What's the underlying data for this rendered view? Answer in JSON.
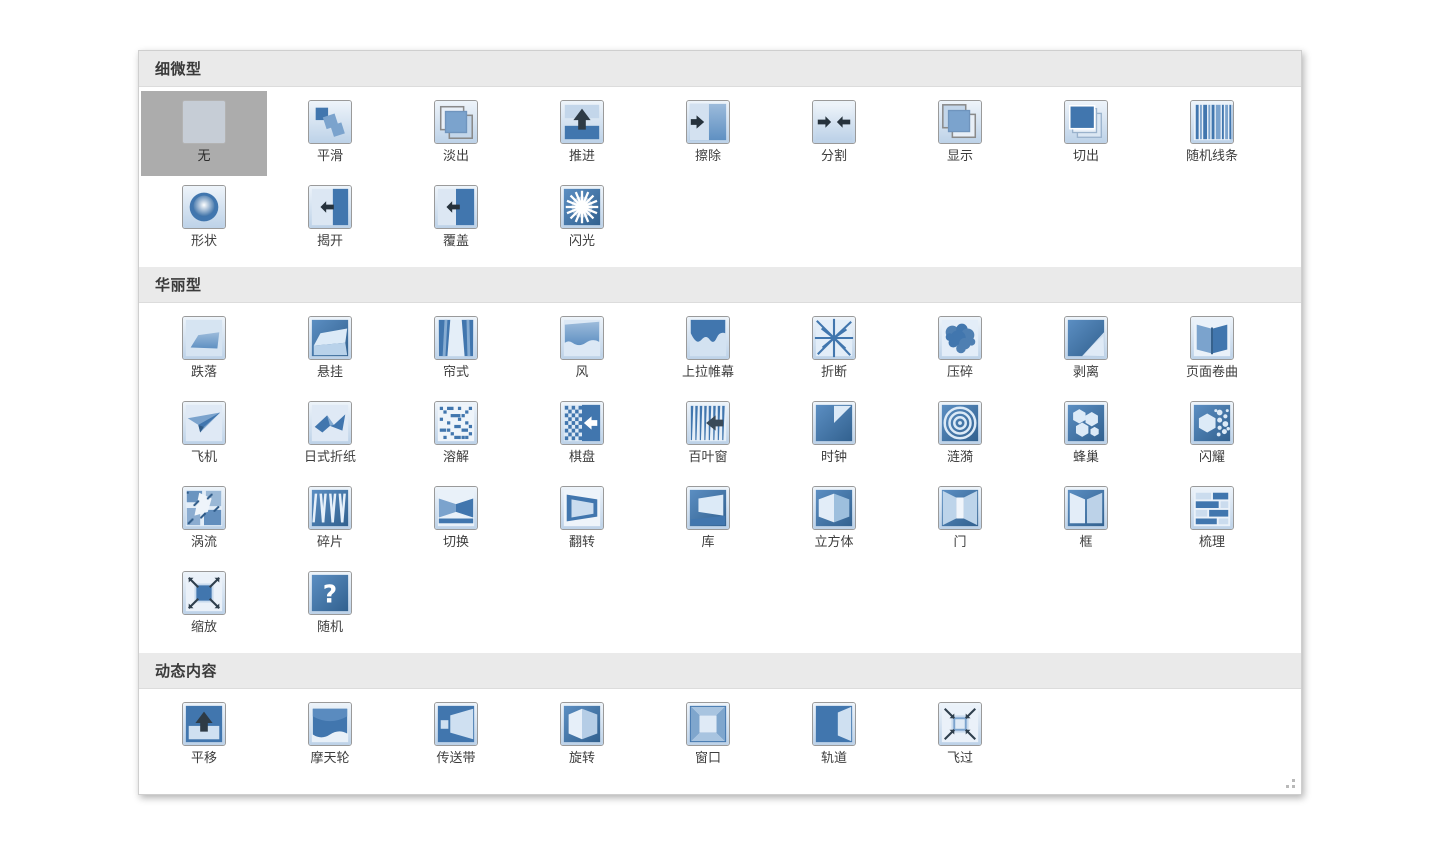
{
  "panel": {
    "name": "transition-gallery",
    "resize_grip": "resize-grip"
  },
  "sections": [
    {
      "id": "subtle",
      "title": "细微型",
      "items": [
        {
          "label": "无",
          "icon": "none",
          "selected": true
        },
        {
          "label": "平滑",
          "icon": "morph",
          "selected": false
        },
        {
          "label": "淡出",
          "icon": "fade",
          "selected": false
        },
        {
          "label": "推进",
          "icon": "push",
          "selected": false
        },
        {
          "label": "擦除",
          "icon": "wipe",
          "selected": false
        },
        {
          "label": "分割",
          "icon": "split",
          "selected": false
        },
        {
          "label": "显示",
          "icon": "reveal",
          "selected": false
        },
        {
          "label": "切出",
          "icon": "cut",
          "selected": false
        },
        {
          "label": "随机线条",
          "icon": "random-bars",
          "selected": false
        },
        {
          "label": "形状",
          "icon": "shape",
          "selected": false
        },
        {
          "label": "揭开",
          "icon": "uncover",
          "selected": false
        },
        {
          "label": "覆盖",
          "icon": "cover",
          "selected": false
        },
        {
          "label": "闪光",
          "icon": "flash",
          "selected": false
        }
      ]
    },
    {
      "id": "exciting",
      "title": "华丽型",
      "items": [
        {
          "label": "跌落",
          "icon": "fall-over",
          "selected": false
        },
        {
          "label": "悬挂",
          "icon": "drape",
          "selected": false
        },
        {
          "label": "帘式",
          "icon": "curtains",
          "selected": false
        },
        {
          "label": "风",
          "icon": "wind",
          "selected": false
        },
        {
          "label": "上拉帷幕",
          "icon": "prestige",
          "selected": false
        },
        {
          "label": "折断",
          "icon": "fracture",
          "selected": false
        },
        {
          "label": "压碎",
          "icon": "crush",
          "selected": false
        },
        {
          "label": "剥离",
          "icon": "peel-off",
          "selected": false
        },
        {
          "label": "页面卷曲",
          "icon": "page-curl",
          "selected": false
        },
        {
          "label": "飞机",
          "icon": "airplane",
          "selected": false
        },
        {
          "label": "日式折纸",
          "icon": "origami",
          "selected": false
        },
        {
          "label": "溶解",
          "icon": "dissolve",
          "selected": false
        },
        {
          "label": "棋盘",
          "icon": "checkerboard",
          "selected": false
        },
        {
          "label": "百叶窗",
          "icon": "blinds",
          "selected": false
        },
        {
          "label": "时钟",
          "icon": "clock",
          "selected": false
        },
        {
          "label": "涟漪",
          "icon": "ripple",
          "selected": false
        },
        {
          "label": "蜂巢",
          "icon": "honeycomb",
          "selected": false
        },
        {
          "label": "闪耀",
          "icon": "glitter",
          "selected": false
        },
        {
          "label": "涡流",
          "icon": "vortex",
          "selected": false
        },
        {
          "label": "碎片",
          "icon": "shred",
          "selected": false
        },
        {
          "label": "切换",
          "icon": "switch",
          "selected": false
        },
        {
          "label": "翻转",
          "icon": "flip",
          "selected": false
        },
        {
          "label": "库",
          "icon": "gallery",
          "selected": false
        },
        {
          "label": "立方体",
          "icon": "cube",
          "selected": false
        },
        {
          "label": "门",
          "icon": "doors",
          "selected": false
        },
        {
          "label": "框",
          "icon": "box",
          "selected": false
        },
        {
          "label": "梳理",
          "icon": "comb",
          "selected": false
        },
        {
          "label": "缩放",
          "icon": "zoom",
          "selected": false
        },
        {
          "label": "随机",
          "icon": "random",
          "selected": false
        }
      ]
    },
    {
      "id": "dynamic",
      "title": "动态内容",
      "items": [
        {
          "label": "平移",
          "icon": "pan",
          "selected": false
        },
        {
          "label": "摩天轮",
          "icon": "ferris-wheel",
          "selected": false
        },
        {
          "label": "传送带",
          "icon": "conveyor",
          "selected": false
        },
        {
          "label": "旋转",
          "icon": "rotate",
          "selected": false
        },
        {
          "label": "窗口",
          "icon": "window",
          "selected": false
        },
        {
          "label": "轨道",
          "icon": "orbit",
          "selected": false
        },
        {
          "label": "飞过",
          "icon": "fly-through",
          "selected": false
        }
      ]
    }
  ],
  "colors": {
    "accent_dark": "#4176ae",
    "accent_mid": "#7ba3cd",
    "accent_light": "#c3d6ea",
    "tile_bg": "#dfe7f1",
    "header_bg": "#eaeaea",
    "selection_bg": "#acacac",
    "text": "#3d3d3d"
  }
}
